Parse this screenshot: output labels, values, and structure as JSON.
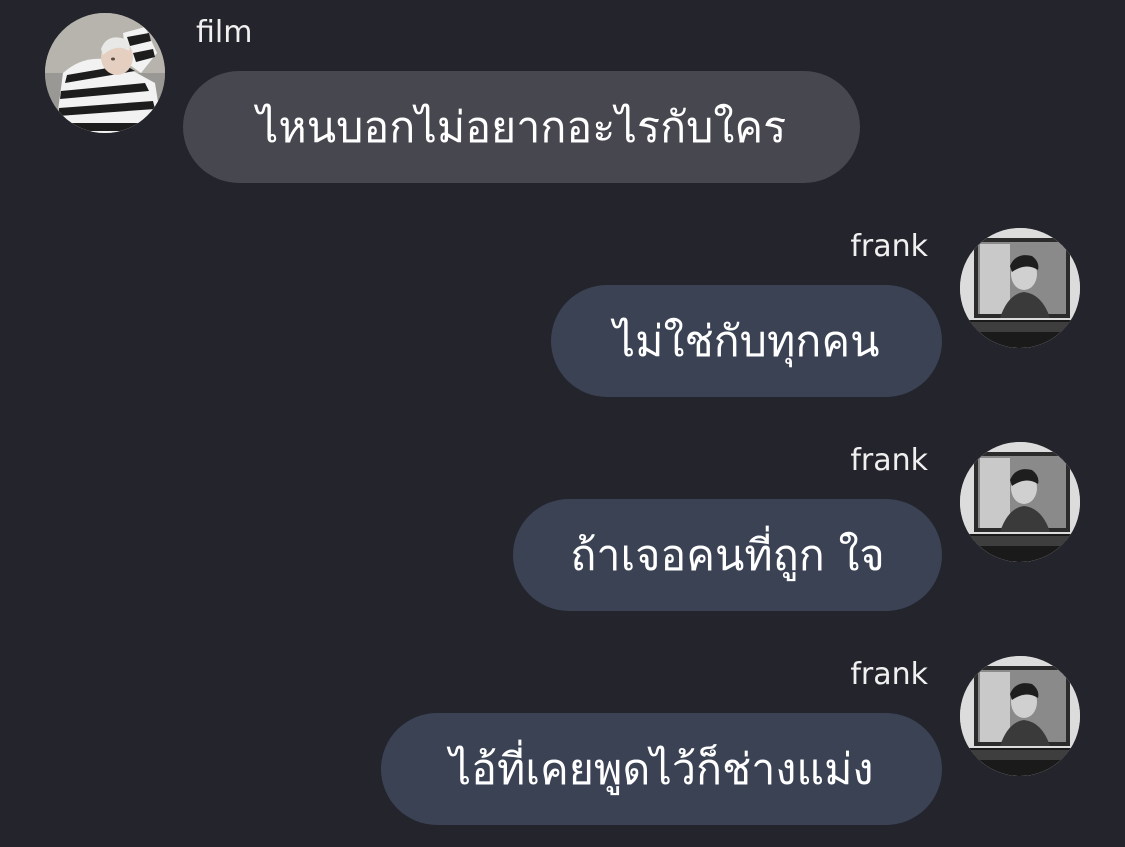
{
  "conversation": {
    "messages": [
      {
        "direction": "incoming",
        "sender": "film",
        "text": "ไหนบอกไม่อยากอะไรกับใคร",
        "avatar_icon": "film-profile-photo"
      },
      {
        "direction": "outgoing",
        "sender": "frank",
        "text": "ไม่ใช่กับทุกคน",
        "avatar_icon": "frank-profile-photo"
      },
      {
        "direction": "outgoing",
        "sender": "frank",
        "text": "ถ้าเจอคนที่ถูก ใจ",
        "avatar_icon": "frank-profile-photo"
      },
      {
        "direction": "outgoing",
        "sender": "frank",
        "text": "ไอ้ที่เคยพูดไว้ก็ช่างแม่ง",
        "avatar_icon": "frank-profile-photo"
      }
    ]
  },
  "colors": {
    "background": "#24252c",
    "incoming_bubble": "#46474f",
    "outgoing_bubble": "#3a4254",
    "text": "#ffffff"
  }
}
